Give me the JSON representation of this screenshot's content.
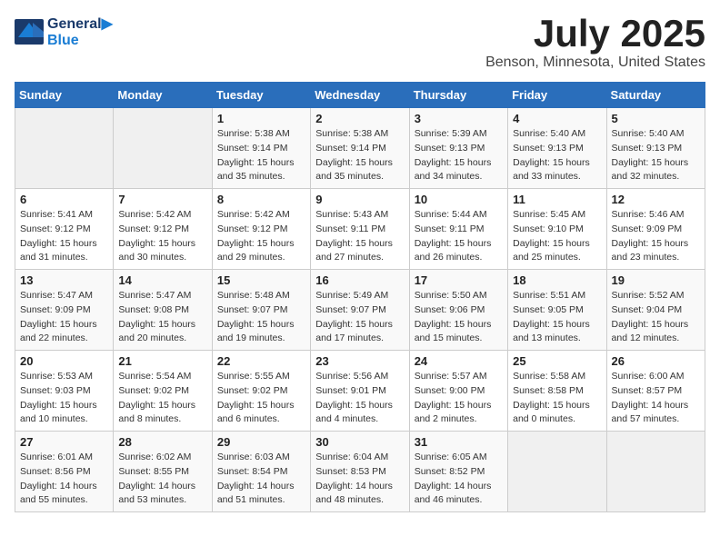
{
  "header": {
    "logo_line1": "General",
    "logo_line2": "Blue",
    "title": "July 2025",
    "location": "Benson, Minnesota, United States"
  },
  "days_of_week": [
    "Sunday",
    "Monday",
    "Tuesday",
    "Wednesday",
    "Thursday",
    "Friday",
    "Saturday"
  ],
  "weeks": [
    [
      {
        "day": "",
        "detail": ""
      },
      {
        "day": "",
        "detail": ""
      },
      {
        "day": "1",
        "detail": "Sunrise: 5:38 AM\nSunset: 9:14 PM\nDaylight: 15 hours and 35 minutes."
      },
      {
        "day": "2",
        "detail": "Sunrise: 5:38 AM\nSunset: 9:14 PM\nDaylight: 15 hours and 35 minutes."
      },
      {
        "day": "3",
        "detail": "Sunrise: 5:39 AM\nSunset: 9:13 PM\nDaylight: 15 hours and 34 minutes."
      },
      {
        "day": "4",
        "detail": "Sunrise: 5:40 AM\nSunset: 9:13 PM\nDaylight: 15 hours and 33 minutes."
      },
      {
        "day": "5",
        "detail": "Sunrise: 5:40 AM\nSunset: 9:13 PM\nDaylight: 15 hours and 32 minutes."
      }
    ],
    [
      {
        "day": "6",
        "detail": "Sunrise: 5:41 AM\nSunset: 9:12 PM\nDaylight: 15 hours and 31 minutes."
      },
      {
        "day": "7",
        "detail": "Sunrise: 5:42 AM\nSunset: 9:12 PM\nDaylight: 15 hours and 30 minutes."
      },
      {
        "day": "8",
        "detail": "Sunrise: 5:42 AM\nSunset: 9:12 PM\nDaylight: 15 hours and 29 minutes."
      },
      {
        "day": "9",
        "detail": "Sunrise: 5:43 AM\nSunset: 9:11 PM\nDaylight: 15 hours and 27 minutes."
      },
      {
        "day": "10",
        "detail": "Sunrise: 5:44 AM\nSunset: 9:11 PM\nDaylight: 15 hours and 26 minutes."
      },
      {
        "day": "11",
        "detail": "Sunrise: 5:45 AM\nSunset: 9:10 PM\nDaylight: 15 hours and 25 minutes."
      },
      {
        "day": "12",
        "detail": "Sunrise: 5:46 AM\nSunset: 9:09 PM\nDaylight: 15 hours and 23 minutes."
      }
    ],
    [
      {
        "day": "13",
        "detail": "Sunrise: 5:47 AM\nSunset: 9:09 PM\nDaylight: 15 hours and 22 minutes."
      },
      {
        "day": "14",
        "detail": "Sunrise: 5:47 AM\nSunset: 9:08 PM\nDaylight: 15 hours and 20 minutes."
      },
      {
        "day": "15",
        "detail": "Sunrise: 5:48 AM\nSunset: 9:07 PM\nDaylight: 15 hours and 19 minutes."
      },
      {
        "day": "16",
        "detail": "Sunrise: 5:49 AM\nSunset: 9:07 PM\nDaylight: 15 hours and 17 minutes."
      },
      {
        "day": "17",
        "detail": "Sunrise: 5:50 AM\nSunset: 9:06 PM\nDaylight: 15 hours and 15 minutes."
      },
      {
        "day": "18",
        "detail": "Sunrise: 5:51 AM\nSunset: 9:05 PM\nDaylight: 15 hours and 13 minutes."
      },
      {
        "day": "19",
        "detail": "Sunrise: 5:52 AM\nSunset: 9:04 PM\nDaylight: 15 hours and 12 minutes."
      }
    ],
    [
      {
        "day": "20",
        "detail": "Sunrise: 5:53 AM\nSunset: 9:03 PM\nDaylight: 15 hours and 10 minutes."
      },
      {
        "day": "21",
        "detail": "Sunrise: 5:54 AM\nSunset: 9:02 PM\nDaylight: 15 hours and 8 minutes."
      },
      {
        "day": "22",
        "detail": "Sunrise: 5:55 AM\nSunset: 9:02 PM\nDaylight: 15 hours and 6 minutes."
      },
      {
        "day": "23",
        "detail": "Sunrise: 5:56 AM\nSunset: 9:01 PM\nDaylight: 15 hours and 4 minutes."
      },
      {
        "day": "24",
        "detail": "Sunrise: 5:57 AM\nSunset: 9:00 PM\nDaylight: 15 hours and 2 minutes."
      },
      {
        "day": "25",
        "detail": "Sunrise: 5:58 AM\nSunset: 8:58 PM\nDaylight: 15 hours and 0 minutes."
      },
      {
        "day": "26",
        "detail": "Sunrise: 6:00 AM\nSunset: 8:57 PM\nDaylight: 14 hours and 57 minutes."
      }
    ],
    [
      {
        "day": "27",
        "detail": "Sunrise: 6:01 AM\nSunset: 8:56 PM\nDaylight: 14 hours and 55 minutes."
      },
      {
        "day": "28",
        "detail": "Sunrise: 6:02 AM\nSunset: 8:55 PM\nDaylight: 14 hours and 53 minutes."
      },
      {
        "day": "29",
        "detail": "Sunrise: 6:03 AM\nSunset: 8:54 PM\nDaylight: 14 hours and 51 minutes."
      },
      {
        "day": "30",
        "detail": "Sunrise: 6:04 AM\nSunset: 8:53 PM\nDaylight: 14 hours and 48 minutes."
      },
      {
        "day": "31",
        "detail": "Sunrise: 6:05 AM\nSunset: 8:52 PM\nDaylight: 14 hours and 46 minutes."
      },
      {
        "day": "",
        "detail": ""
      },
      {
        "day": "",
        "detail": ""
      }
    ]
  ]
}
